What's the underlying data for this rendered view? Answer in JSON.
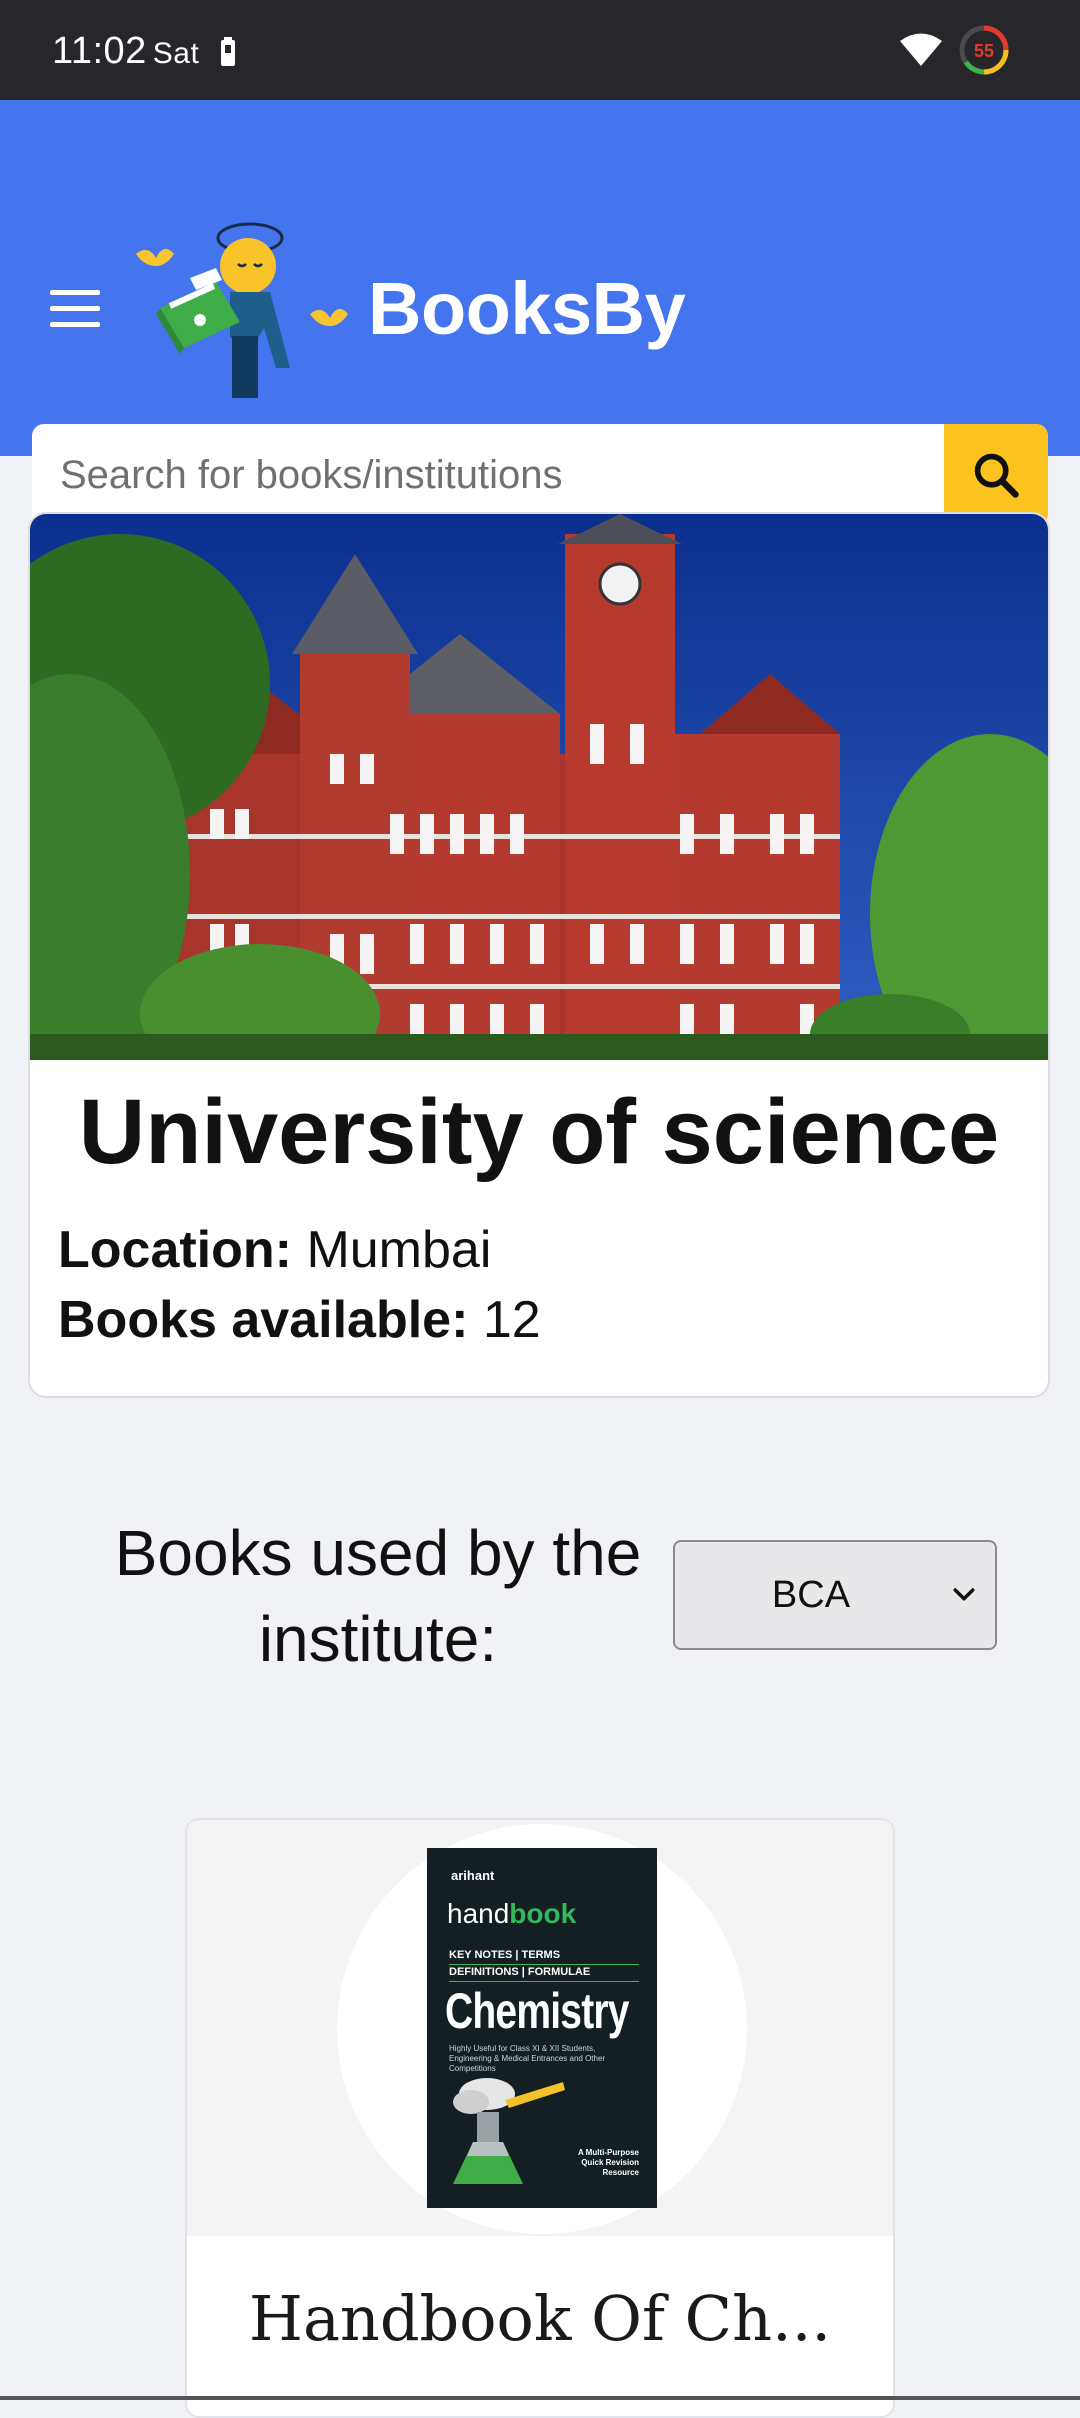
{
  "status_bar": {
    "time": "11:02",
    "day": "Sat",
    "battery_percent": "55",
    "icons": [
      "battery-icon",
      "wifi-icon",
      "data-saver-ring-icon"
    ]
  },
  "header": {
    "brand": "BooksBy",
    "menu_icon": "hamburger-menu-icon",
    "logo_icon": "reader-mascot-logo",
    "search": {
      "placeholder": "Search for books/institutions",
      "value": "",
      "button_icon": "search-icon"
    },
    "colors": {
      "header_bg": "#4474ee",
      "search_button": "#fcc21d"
    }
  },
  "institution": {
    "name": "University of science",
    "location_label": "Location:",
    "location_value": "Mumbai",
    "books_label": "Books available:",
    "books_value": "12",
    "photo": "red-brick-university-building-with-clock-tower"
  },
  "books_section": {
    "heading": "Books used by the institute:",
    "course_selected": "BCA"
  },
  "books": [
    {
      "title": "Handbook Of Ch...",
      "cover": {
        "publisher": "arihant",
        "series_light": "hand",
        "series_bold": "book",
        "keys_line1": "KEY NOTES | TERMS",
        "keys_line2": "DEFINITIONS | FORMULAE",
        "subject": "Chemistry",
        "description": "Highly Useful for Class XI & XII Students, Engineering & Medical Entrances and Other Competitions",
        "tagline": "A Multi-Purpose Quick Revision Resource"
      }
    }
  ]
}
